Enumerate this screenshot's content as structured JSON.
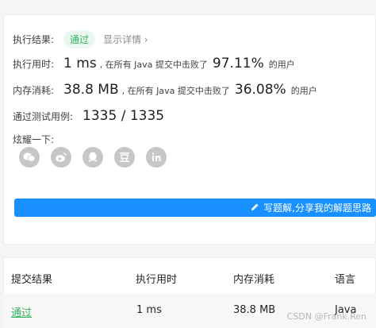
{
  "result": {
    "label": "执行结果:",
    "status": "通过",
    "detail_link": "显示详情 ›"
  },
  "runtime": {
    "label": "执行用时:",
    "value": "1 ms",
    "prefix": ", 在所有 Java 提交中击败了",
    "percent": "97.11%",
    "suffix": "的用户"
  },
  "memory": {
    "label": "内存消耗:",
    "value": "38.8 MB",
    "prefix": ", 在所有 Java 提交中击败了",
    "percent": "36.08%",
    "suffix": "的用户"
  },
  "tests": {
    "label": "通过测试用例:",
    "value": "1335 / 1335"
  },
  "share": {
    "label": "炫耀一下:",
    "icons": [
      "wechat-icon",
      "weibo-icon",
      "qq-icon",
      "douban-icon",
      "linkedin-icon"
    ]
  },
  "write_button": {
    "label": "写题解,分享我的解题思路"
  },
  "table": {
    "headers": [
      "提交结果",
      "执行用时",
      "内存消耗",
      "语言"
    ],
    "row": {
      "status": "通过",
      "time": "1 ms",
      "memory": "38.8 MB",
      "language": "Java"
    }
  },
  "watermark": "CSDN @Frank.Ren",
  "colors": {
    "success": "#2db55d",
    "primary": "#1890ff",
    "icon_gray": "#c7c7c7"
  }
}
